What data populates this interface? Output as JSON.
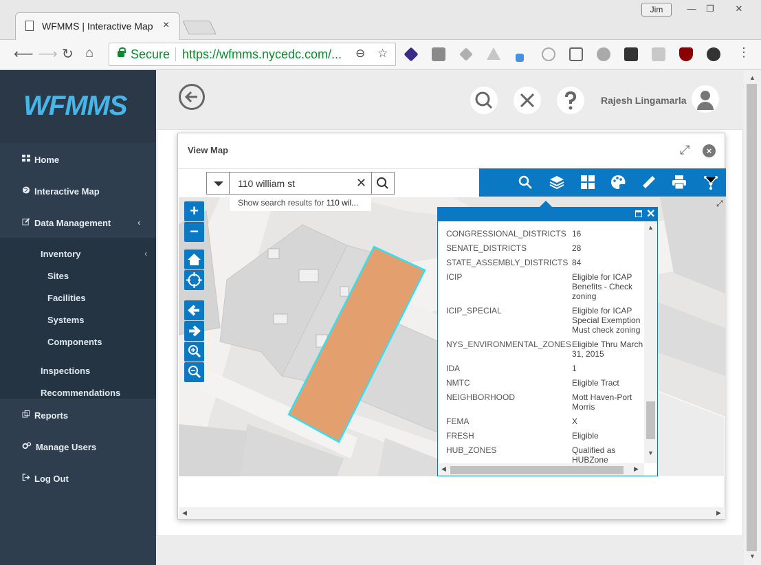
{
  "browser": {
    "tab_title": "WFMMS | Interactive Map",
    "tab_close": "×",
    "user_chip": "Jim",
    "secure_label": "Secure",
    "url": "https://wfmms.nycedc.com/...",
    "win_min": "—",
    "win_max": "❐",
    "win_close": "✕"
  },
  "sidebar": {
    "logo": "WFMMS",
    "items": [
      {
        "label": "Home",
        "icon": "grid-icon"
      },
      {
        "label": "Interactive Map",
        "icon": "globe-icon"
      },
      {
        "label": "Data Management",
        "icon": "edit-icon"
      },
      {
        "label": "Reports",
        "icon": "copy-icon"
      },
      {
        "label": "Manage Users",
        "icon": "gears-icon"
      },
      {
        "label": "Log Out",
        "icon": "logout-icon"
      }
    ],
    "submenu": {
      "inventory": "Inventory",
      "inventory_children": [
        "Sites",
        "Facilities",
        "Systems",
        "Components"
      ],
      "inspections": "Inspections",
      "recommendations": "Recommendations"
    }
  },
  "header": {
    "username": "Rajesh Lingamarla"
  },
  "modal": {
    "title": "View Map",
    "search_value": "110 william st",
    "suggestion": "Show search results for 110 wil...",
    "suggestion_prefix": "Show search results for ",
    "suggestion_bold": "110 wil..."
  },
  "popup": {
    "rows": [
      {
        "key": "CONGRESSIONAL_DISTRICTS",
        "value": "16"
      },
      {
        "key": "SENATE_DISTRICTS",
        "value": "28"
      },
      {
        "key": "STATE_ASSEMBLY_DISTRICTS",
        "value": "84"
      },
      {
        "key": "ICIP",
        "value": "Eligible for ICAP Benefits - Check zoning"
      },
      {
        "key": "ICIP_SPECIAL",
        "value": "Eligible for ICAP Special Exemption Must check zoning"
      },
      {
        "key": "NYS_ENVIRONMENTAL_ZONES",
        "value": "Eligible Thru March 31, 2015"
      },
      {
        "key": "IDA",
        "value": "1"
      },
      {
        "key": "NMTC",
        "value": "Eligible Tract"
      },
      {
        "key": "NEIGHBORHOOD",
        "value": "Mott Haven-Port Morris"
      },
      {
        "key": "FEMA",
        "value": "X"
      },
      {
        "key": "FRESH",
        "value": "Eligible"
      },
      {
        "key": "HUB_ZONES",
        "value": "Qualified as HUBZone"
      }
    ]
  },
  "colors": {
    "accent": "#0a78c3",
    "sidebar": "#2e3e4e",
    "parcel_fill": "#e39f6e",
    "parcel_outline": "#33e0f0",
    "secure_green": "#0a8a2d",
    "logo_blue": "#44b6e9"
  }
}
